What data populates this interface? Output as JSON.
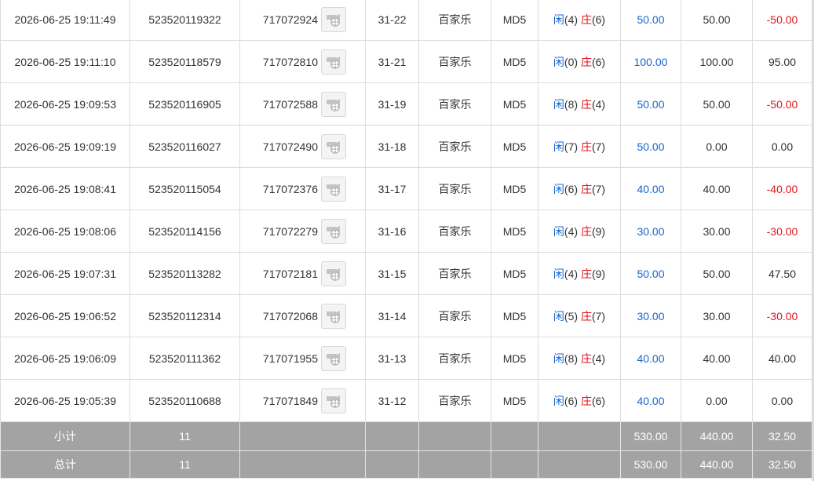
{
  "rows": [
    {
      "time": "2026-06-25 19:11:49",
      "order_no": "523520119322",
      "round_no": "717072924",
      "shoe": "31-22",
      "game": "百家乐",
      "method": "MD5",
      "player_label": "闲",
      "player_score": "(4)",
      "banker_label": "庄",
      "banker_score": "(6)",
      "bet": "50.00",
      "valid_bet": "50.00",
      "win_loss": "-50.00",
      "win_loss_type": "neg"
    },
    {
      "time": "2026-06-25 19:11:10",
      "order_no": "523520118579",
      "round_no": "717072810",
      "shoe": "31-21",
      "game": "百家乐",
      "method": "MD5",
      "player_label": "闲",
      "player_score": "(0)",
      "banker_label": "庄",
      "banker_score": "(6)",
      "bet": "100.00",
      "valid_bet": "100.00",
      "win_loss": "95.00",
      "win_loss_type": "pos"
    },
    {
      "time": "2026-06-25 19:09:53",
      "order_no": "523520116905",
      "round_no": "717072588",
      "shoe": "31-19",
      "game": "百家乐",
      "method": "MD5",
      "player_label": "闲",
      "player_score": "(8)",
      "banker_label": "庄",
      "banker_score": "(4)",
      "bet": "50.00",
      "valid_bet": "50.00",
      "win_loss": "-50.00",
      "win_loss_type": "neg"
    },
    {
      "time": "2026-06-25 19:09:19",
      "order_no": "523520116027",
      "round_no": "717072490",
      "shoe": "31-18",
      "game": "百家乐",
      "method": "MD5",
      "player_label": "闲",
      "player_score": "(7)",
      "banker_label": "庄",
      "banker_score": "(7)",
      "bet": "50.00",
      "valid_bet": "0.00",
      "win_loss": "0.00",
      "win_loss_type": "pos"
    },
    {
      "time": "2026-06-25 19:08:41",
      "order_no": "523520115054",
      "round_no": "717072376",
      "shoe": "31-17",
      "game": "百家乐",
      "method": "MD5",
      "player_label": "闲",
      "player_score": "(6)",
      "banker_label": "庄",
      "banker_score": "(7)",
      "bet": "40.00",
      "valid_bet": "40.00",
      "win_loss": "-40.00",
      "win_loss_type": "neg"
    },
    {
      "time": "2026-06-25 19:08:06",
      "order_no": "523520114156",
      "round_no": "717072279",
      "shoe": "31-16",
      "game": "百家乐",
      "method": "MD5",
      "player_label": "闲",
      "player_score": "(4)",
      "banker_label": "庄",
      "banker_score": "(9)",
      "bet": "30.00",
      "valid_bet": "30.00",
      "win_loss": "-30.00",
      "win_loss_type": "neg"
    },
    {
      "time": "2026-06-25 19:07:31",
      "order_no": "523520113282",
      "round_no": "717072181",
      "shoe": "31-15",
      "game": "百家乐",
      "method": "MD5",
      "player_label": "闲",
      "player_score": "(4)",
      "banker_label": "庄",
      "banker_score": "(9)",
      "bet": "50.00",
      "valid_bet": "50.00",
      "win_loss": "47.50",
      "win_loss_type": "pos"
    },
    {
      "time": "2026-06-25 19:06:52",
      "order_no": "523520112314",
      "round_no": "717072068",
      "shoe": "31-14",
      "game": "百家乐",
      "method": "MD5",
      "player_label": "闲",
      "player_score": "(5)",
      "banker_label": "庄",
      "banker_score": "(7)",
      "bet": "30.00",
      "valid_bet": "30.00",
      "win_loss": "-30.00",
      "win_loss_type": "neg"
    },
    {
      "time": "2026-06-25 19:06:09",
      "order_no": "523520111362",
      "round_no": "717071955",
      "shoe": "31-13",
      "game": "百家乐",
      "method": "MD5",
      "player_label": "闲",
      "player_score": "(8)",
      "banker_label": "庄",
      "banker_score": "(4)",
      "bet": "40.00",
      "valid_bet": "40.00",
      "win_loss": "40.00",
      "win_loss_type": "pos"
    },
    {
      "time": "2026-06-25 19:05:39",
      "order_no": "523520110688",
      "round_no": "717071849",
      "shoe": "31-12",
      "game": "百家乐",
      "method": "MD5",
      "player_label": "闲",
      "player_score": "(6)",
      "banker_label": "庄",
      "banker_score": "(6)",
      "bet": "40.00",
      "valid_bet": "0.00",
      "win_loss": "0.00",
      "win_loss_type": "pos"
    }
  ],
  "subtotal": {
    "label": "小计",
    "count": "11",
    "bet": "530.00",
    "valid_bet": "440.00",
    "win_loss": "32.50"
  },
  "total": {
    "label": "总计",
    "count": "11",
    "bet": "530.00",
    "valid_bet": "440.00",
    "win_loss": "32.50"
  },
  "colors": {
    "player": "#1a66cc",
    "banker": "#e0141e",
    "summary_bg": "#a3a3a3",
    "border": "#dcdcdc"
  },
  "icons": {
    "video": "video-replay-icon"
  }
}
